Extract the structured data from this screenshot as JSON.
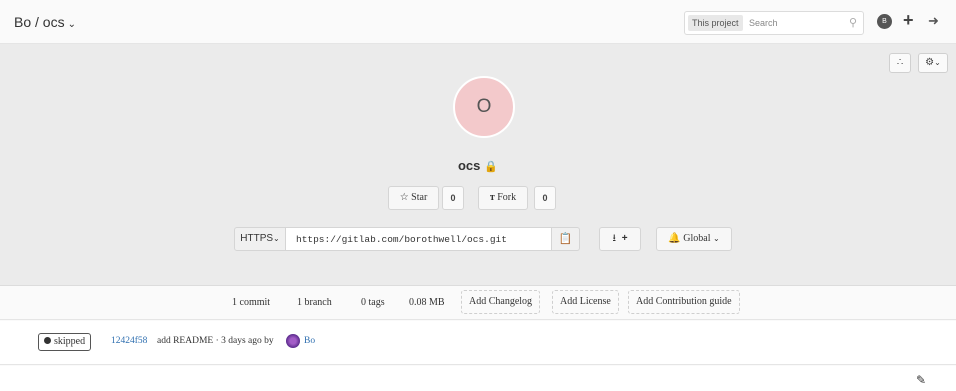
{
  "navbar": {
    "brand": "Bo / ocs",
    "search_scope": "This project",
    "search_placeholder": "Search",
    "user_avatar_letter": "B"
  },
  "project": {
    "avatar_letter": "O",
    "name": "ocs",
    "star_label": "Star",
    "star_count": "0",
    "fork_label": "Fork",
    "fork_count": "0",
    "protocol_label": "HTTPS",
    "clone_url": "https://gitlab.com/borothwell/ocs.git",
    "notification_label": "Global"
  },
  "stats": {
    "commits": "1 commit",
    "branches": "1 branch",
    "tags": "0 tags",
    "size": "0.08 MB",
    "add_changelog": "Add Changelog",
    "add_license": "Add License",
    "add_contribution": "Add Contribution guide"
  },
  "last_commit": {
    "status": "skipped",
    "sha": "12424f58",
    "message": "add README · 3 days ago by",
    "author": "Bo"
  },
  "icons": {
    "rss": "rss-icon",
    "gear": "gear-icon",
    "lock": "lock-icon",
    "star": "star-icon",
    "fork": "fork-icon",
    "copy": "clipboard-icon",
    "download": "download-icon",
    "plus": "plus-icon",
    "bell": "bell-icon",
    "edit": "pencil-icon",
    "search": "search-icon",
    "signout": "sign-out-icon"
  },
  "colors": {
    "avatar_bg": "#f3c9cb",
    "link": "#2f6fb0",
    "header_bg": "#ebebeb"
  }
}
